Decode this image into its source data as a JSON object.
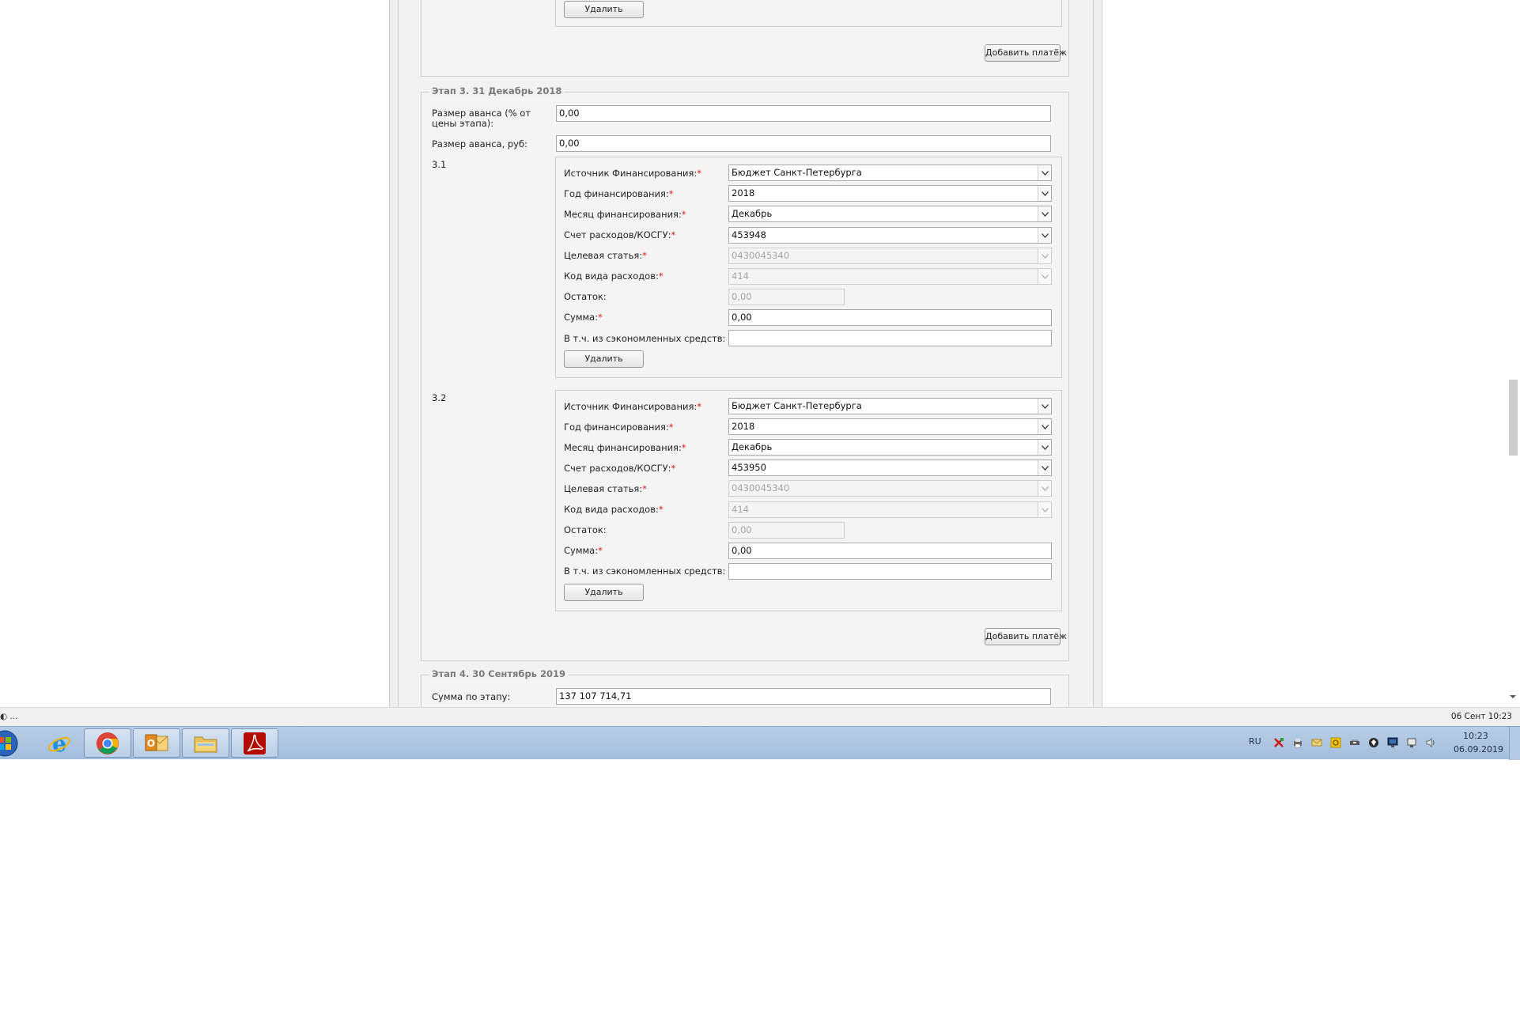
{
  "form": {
    "top_fragment": {
      "delete_label": "Удалить",
      "add_payment_label": "Добавить платёж"
    },
    "stage3": {
      "legend": "Этап 3. 31 Декабрь 2018",
      "advance_pct_label": "Размер аванса (% от цены этапа):",
      "advance_pct_value": "0,00",
      "advance_rub_label": "Размер аванса, руб:",
      "advance_rub_value": "0,00",
      "add_payment_label": "Добавить платёж",
      "payments": [
        {
          "number": "3.1",
          "source_label": "Источник Финансирования:",
          "source_value": "Бюджет Санкт-Петербурга",
          "year_label": "Год финансирования:",
          "year_value": "2018",
          "month_label": "Месяц финансирования:",
          "month_value": "Декабрь",
          "account_label": "Счет расходов/КОСГУ:",
          "account_value": "453948",
          "target_label": "Целевая статья:",
          "target_value": "0430045340",
          "kind_label": "Код вида расходов:",
          "kind_value": "414",
          "remainder_label": "Остаток:",
          "remainder_value": "0,00",
          "sum_label": "Сумма:",
          "sum_value": "0,00",
          "saved_label": "В т.ч. из сэкономленных средств:",
          "saved_value": "",
          "delete_label": "Удалить"
        },
        {
          "number": "3.2",
          "source_label": "Источник Финансирования:",
          "source_value": "Бюджет Санкт-Петербурга",
          "year_label": "Год финансирования:",
          "year_value": "2018",
          "month_label": "Месяц финансирования:",
          "month_value": "Декабрь",
          "account_label": "Счет расходов/КОСГУ:",
          "account_value": "453950",
          "target_label": "Целевая статья:",
          "target_value": "0430045340",
          "kind_label": "Код вида расходов:",
          "kind_value": "414",
          "remainder_label": "Остаток:",
          "remainder_value": "0,00",
          "sum_label": "Сумма:",
          "sum_value": "0,00",
          "saved_label": "В т.ч. из сэкономленных средств:",
          "saved_value": "",
          "delete_label": "Удалить"
        }
      ]
    },
    "stage4": {
      "legend": "Этап 4. 30 Сентябрь 2019",
      "sum_label": "Сумма по этапу:",
      "sum_value": "137 107 714,71"
    },
    "required_mark": "*"
  },
  "statusbar": {
    "left_text": "◐ ...",
    "right_text": "06 Сент 10:23"
  },
  "taskbar": {
    "apps": [
      "start-orb",
      "internet-explorer",
      "chrome",
      "outlook",
      "file-explorer",
      "acrobat-reader"
    ],
    "language": "RU",
    "clock_time": "10:23",
    "clock_date": "06.09.2019"
  },
  "colors": {
    "required": "#d31c1c",
    "taskbar": "#a3bedd",
    "page_bg": "#f2f2f2"
  }
}
